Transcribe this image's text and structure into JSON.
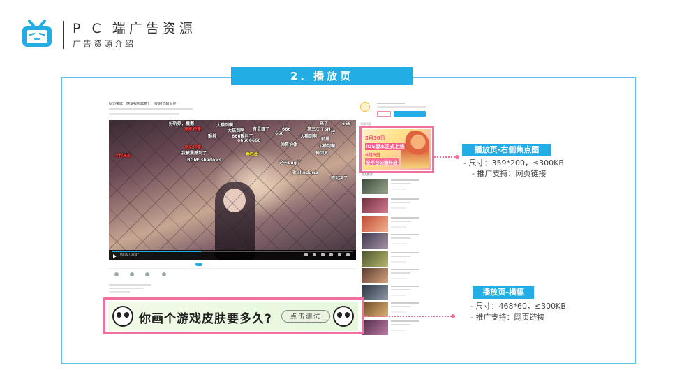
{
  "header": {
    "title": "P C 端广告资源",
    "subtitle": "广告资源介绍"
  },
  "section": {
    "title": "2. 播放页"
  },
  "page_mock": {
    "video_title": "妈力雾阵！感受视听震撼！一秒30边的世界！",
    "danmaku": [
      "好听欸，震撼",
      "大猫到啊",
      "来了",
      "666",
      "高能预警",
      "大猫到啊",
      "有灵魂了",
      "666",
      "第三次 TSN",
      "好",
      "666",
      "颤抖",
      "666颤抖了",
      "大猫到啊",
      "66666666",
      "前排",
      "弹幕护体",
      "高能预警",
      "大猫到啊",
      "我被震撼到了",
      "全程高能",
      "BGM: shadows",
      "能 shadows",
      "奏鸣曲",
      "这卡bug了",
      "神回复",
      "感动哭了"
    ],
    "player_time": "00:00 / 03:47",
    "sidebar_tab": "弹幕列表",
    "related_label": "相关推荐"
  },
  "ads": {
    "right_ad": {
      "line1": "5月30日",
      "line2": "iOS版本正式上线",
      "line3": "6月5日",
      "line4": "全平台公测开启"
    },
    "banner_ad": {
      "text": "你画个游戏皮肤要多久?",
      "cta": "点击测试"
    }
  },
  "annotations": [
    {
      "tag": "播放页-右侧焦点图",
      "size": "- 尺寸：359*200，≤300KB",
      "support": "- 推广支持：网页链接"
    },
    {
      "tag": "播放页-横幅",
      "size": "- 尺寸：468*60，≤300KB",
      "support": "- 推广支持：网页链接"
    }
  ],
  "colors": {
    "accent_blue": "#23ade5",
    "highlight_pink": "#f3709e",
    "frame_border": "#5fc3e7"
  },
  "icons": [
    "bilibili-tv-logo-icon"
  ]
}
